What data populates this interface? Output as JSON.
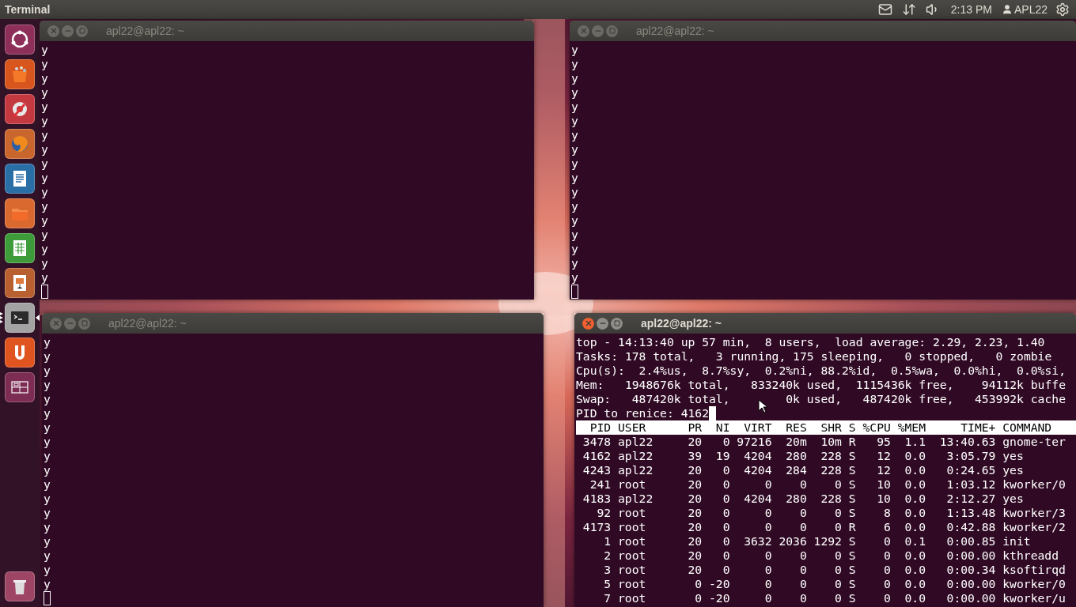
{
  "top_panel": {
    "app_title": "Terminal",
    "clock": "2:13 PM",
    "user": "APL22"
  },
  "launcher": {
    "items": [
      {
        "kind": "dash",
        "running": false,
        "focused": false
      },
      {
        "kind": "software",
        "running": false,
        "focused": false
      },
      {
        "kind": "settings",
        "running": false,
        "focused": false
      },
      {
        "kind": "browser",
        "running": false,
        "focused": false
      },
      {
        "kind": "writer",
        "running": false,
        "focused": false
      },
      {
        "kind": "files",
        "running": false,
        "focused": false
      },
      {
        "kind": "calc",
        "running": false,
        "focused": false
      },
      {
        "kind": "impress",
        "running": false,
        "focused": false
      },
      {
        "kind": "terminal",
        "running": true,
        "focused": true
      },
      {
        "kind": "one",
        "running": false,
        "focused": false
      },
      {
        "kind": "workspaces",
        "running": false,
        "focused": false
      },
      {
        "kind": "trash",
        "running": false,
        "focused": false
      }
    ]
  },
  "windows": [
    {
      "title": "apl22@apl22: ~",
      "active": false,
      "lines": [
        "y",
        "y",
        "y",
        "y",
        "y",
        "y",
        "y",
        "y",
        "y",
        "y",
        "y",
        "y",
        "y",
        "y",
        "y",
        "y",
        "y"
      ]
    },
    {
      "title": "apl22@apl22: ~",
      "active": false,
      "lines": [
        "y",
        "y",
        "y",
        "y",
        "y",
        "y",
        "y",
        "y",
        "y",
        "y",
        "y",
        "y",
        "y",
        "y",
        "y",
        "y",
        "y"
      ]
    },
    {
      "title": "apl22@apl22: ~",
      "active": false,
      "lines": [
        "y",
        "y",
        "y",
        "y",
        "y",
        "y",
        "y",
        "y",
        "y",
        "y",
        "y",
        "y",
        "y",
        "y",
        "y",
        "y",
        "y",
        "y"
      ]
    },
    {
      "title": "apl22@apl22: ~",
      "active": true,
      "lines": [
        "top - 14:13:40 up 57 min,  8 users,  load average: 2.29, 2.23, 1.40",
        "Tasks: 178 total,   3 running, 175 sleeping,   0 stopped,   0 zombie",
        "Cpu(s):  2.4%us,  8.7%sy,  0.2%ni, 88.2%id,  0.5%wa,  0.0%hi,  0.0%si,",
        "Mem:   1948676k total,   833240k used,  1115436k free,    94112k buffe",
        "Swap:   487420k total,        0k used,   487420k free,   453992k cache",
        "PID to renice: 4162"
      ],
      "table": {
        "columns": [
          "PID",
          "USER",
          "PR",
          "NI",
          "VIRT",
          "RES",
          "SHR",
          "S",
          "%CPU",
          "%MEM",
          "TIME+",
          "COMMAND"
        ],
        "rows": [
          [
            "3478",
            "apl22",
            "20",
            "0",
            "97216",
            "20m",
            "10m",
            "R",
            "95",
            "1.1",
            "13:40.63",
            "gnome-ter"
          ],
          [
            "4162",
            "apl22",
            "39",
            "19",
            "4204",
            "280",
            "228",
            "S",
            "12",
            "0.0",
            "3:05.79",
            "yes"
          ],
          [
            "4243",
            "apl22",
            "20",
            "0",
            "4204",
            "284",
            "228",
            "S",
            "12",
            "0.0",
            "0:24.65",
            "yes"
          ],
          [
            "241",
            "root",
            "20",
            "0",
            "0",
            "0",
            "0",
            "S",
            "10",
            "0.0",
            "1:03.12",
            "kworker/0"
          ],
          [
            "4183",
            "apl22",
            "20",
            "0",
            "4204",
            "280",
            "228",
            "S",
            "10",
            "0.0",
            "2:12.27",
            "yes"
          ],
          [
            "92",
            "root",
            "20",
            "0",
            "0",
            "0",
            "0",
            "S",
            "8",
            "0.0",
            "1:13.48",
            "kworker/3"
          ],
          [
            "4173",
            "root",
            "20",
            "0",
            "0",
            "0",
            "0",
            "R",
            "6",
            "0.0",
            "0:42.88",
            "kworker/2"
          ],
          [
            "1",
            "root",
            "20",
            "0",
            "3632",
            "2036",
            "1292",
            "S",
            "0",
            "0.1",
            "0:00.85",
            "init"
          ],
          [
            "2",
            "root",
            "20",
            "0",
            "0",
            "0",
            "0",
            "S",
            "0",
            "0.0",
            "0:00.00",
            "kthreadd"
          ],
          [
            "3",
            "root",
            "20",
            "0",
            "0",
            "0",
            "0",
            "S",
            "0",
            "0.0",
            "0:00.34",
            "ksoftirqd"
          ],
          [
            "5",
            "root",
            "0",
            "-20",
            "0",
            "0",
            "0",
            "S",
            "0",
            "0.0",
            "0:00.00",
            "kworker/0"
          ],
          [
            "7",
            "root",
            "0",
            "-20",
            "0",
            "0",
            "0",
            "S",
            "0",
            "0.0",
            "0:00.00",
            "kworker/u"
          ]
        ]
      }
    }
  ]
}
